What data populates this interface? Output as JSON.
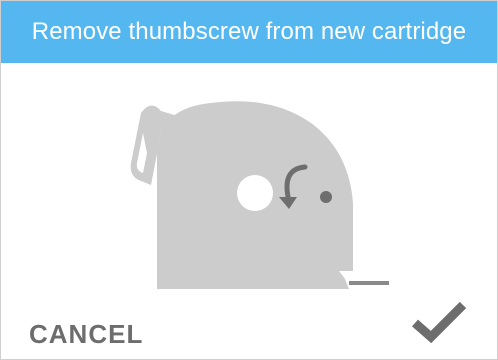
{
  "dialog": {
    "title": "Remove thumbscrew from new cartridge",
    "cancel_label": "CANCEL",
    "confirm_icon": "checkmark-icon"
  },
  "colors": {
    "header_bg": "#55b7f0",
    "header_text": "#ffffff",
    "illustration_fill": "#cccccc",
    "illustration_detail": "#6e6e6e",
    "cancel_text": "#6d6d6d",
    "check_color": "#6d6d6d"
  }
}
